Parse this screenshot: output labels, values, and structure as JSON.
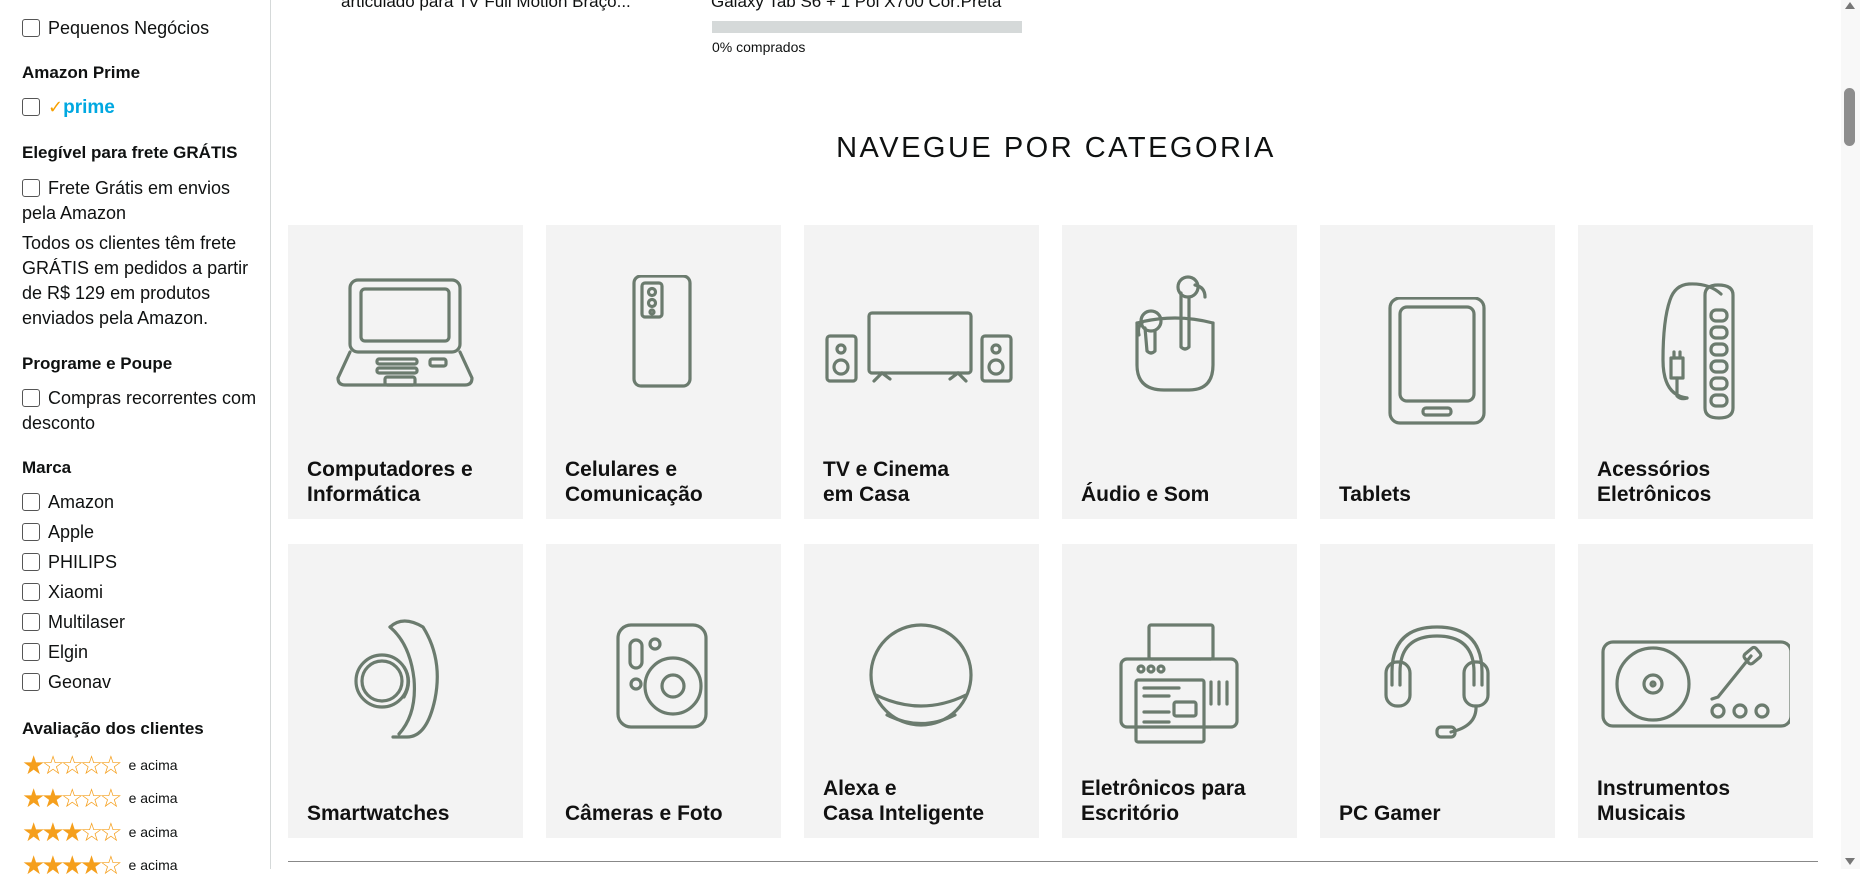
{
  "sidebar": {
    "small_business_label": "Pequenos Negócios",
    "amazon_prime_heading": "Amazon Prime",
    "prime_logo_text": "prime",
    "free_shipping_heading": "Elegível para frete GRÁTIS",
    "free_shipping_option": "Frete Grátis em envios pela Amazon",
    "free_shipping_note": "Todos os clientes têm frete GRÁTIS em pedidos a partir de R$ 129 em produtos enviados pela Amazon.",
    "subscribe_heading": "Programe e Poupe",
    "subscribe_option": "Compras recorrentes com desconto",
    "brand_heading": "Marca",
    "brands": [
      "Amazon",
      "Apple",
      "PHILIPS",
      "Xiaomi",
      "Multilaser",
      "Elgin",
      "Geonav"
    ],
    "rating_heading": "Avaliação dos clientes",
    "ratings": [
      {
        "stars": 1,
        "label": "e acima"
      },
      {
        "stars": 2,
        "label": "e acima"
      },
      {
        "stars": 3,
        "label": "e acima"
      },
      {
        "stars": 4,
        "label": "e acima"
      }
    ]
  },
  "deals": {
    "item1_text": "articulado para TV Full Motion Braço...",
    "item2_text": "Galaxy Tab S6 + 1 Pol X700 Cor:Preta",
    "progress_fraction": 0.0,
    "progress_label": "0% comprados"
  },
  "categories": {
    "title": "NAVEGUE POR CATEGORIA",
    "items": [
      {
        "label": "Computadores e\nInformática",
        "icon": "laptop-icon"
      },
      {
        "label": "Celulares e\nComunicação",
        "icon": "smartphone-icon"
      },
      {
        "label": "TV e Cinema\nem Casa",
        "icon": "tv-icon"
      },
      {
        "label": "Áudio e Som",
        "icon": "earbuds-icon"
      },
      {
        "label": "Tablets",
        "icon": "tablet-icon"
      },
      {
        "label": "Acessórios\nEletrônicos",
        "icon": "power-strip-icon"
      },
      {
        "label": "Smartwatches",
        "icon": "smartwatch-icon"
      },
      {
        "label": "Câmeras e Foto",
        "icon": "instant-camera-icon"
      },
      {
        "label": "Alexa e\nCasa Inteligente",
        "icon": "smart-speaker-icon"
      },
      {
        "label": "Eletrônicos para\nEscritório",
        "icon": "printer-icon"
      },
      {
        "label": "PC Gamer",
        "icon": "headset-icon"
      },
      {
        "label": "Instrumentos\nMusicais",
        "icon": "turntable-icon"
      }
    ]
  }
}
